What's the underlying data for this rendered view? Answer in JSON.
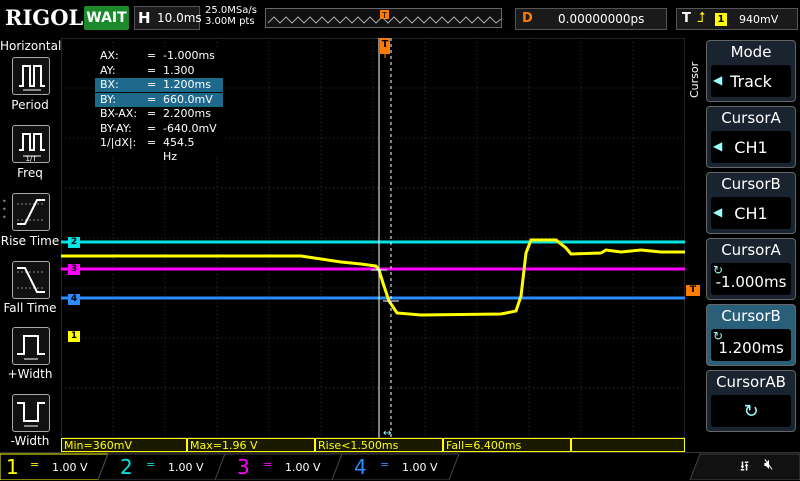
{
  "topbar": {
    "logo": "RIGOL",
    "run_status": "WAIT",
    "timebase_label": "H",
    "timebase_value": "10.0ms",
    "sample_rate": "25.0MSa/s",
    "memory_depth": "3.00M pts",
    "delay_label": "D",
    "delay_value": "0.00000000ps",
    "trigger_type": "T",
    "trigger_source": "1",
    "trigger_level": "940mV"
  },
  "left_menu": {
    "title": "Horizontal",
    "items": [
      {
        "label": "Period",
        "icon": "period-icon"
      },
      {
        "label": "Freq",
        "icon": "freq-icon"
      },
      {
        "label": "Rise Time",
        "icon": "rise-time-icon"
      },
      {
        "label": "Fall Time",
        "icon": "fall-time-icon"
      },
      {
        "label": "+Width",
        "icon": "positive-width-icon"
      },
      {
        "label": "-Width",
        "icon": "negative-width-icon"
      }
    ]
  },
  "cursor_readout": [
    {
      "key": "AX:",
      "eq": "=",
      "value": "-1.000ms",
      "highlight": false
    },
    {
      "key": "AY:",
      "eq": "=",
      "value": "1.300 V",
      "highlight": false
    },
    {
      "key": "BX:",
      "eq": "=",
      "value": "1.200ms",
      "highlight": true
    },
    {
      "key": "BY:",
      "eq": "=",
      "value": "660.0mV",
      "highlight": true
    },
    {
      "key": "BX-AX:",
      "eq": "=",
      "value": "2.200ms",
      "highlight": false
    },
    {
      "key": "BY-AY:",
      "eq": "=",
      "value": "-640.0mV",
      "highlight": false
    },
    {
      "key": "1/|dX|:",
      "eq": "=",
      "value": "454.5 Hz",
      "highlight": false
    }
  ],
  "right_menu": {
    "side_label": "Cursor",
    "items": [
      {
        "caption": "Mode",
        "value": "Track"
      },
      {
        "caption": "CursorA",
        "value": "CH1"
      },
      {
        "caption": "CursorB",
        "value": "CH1"
      },
      {
        "caption": "CursorA",
        "value": "-1.000ms"
      },
      {
        "caption": "CursorB",
        "value": "1.200ms"
      },
      {
        "caption": "CursorAB",
        "value": ""
      }
    ]
  },
  "measurements": {
    "min": "Min=360mV",
    "max": "Max=1.96 V",
    "rise": "Rise<1.500ms",
    "fall": "Fall=6.400ms"
  },
  "channels": [
    {
      "num": "1",
      "scale": "1.00 V",
      "color": "#ffff00"
    },
    {
      "num": "2",
      "scale": "1.00 V",
      "color": "#00e5e5"
    },
    {
      "num": "3",
      "scale": "1.00 V",
      "color": "#ff00ff"
    },
    {
      "num": "4",
      "scale": "1.00 V",
      "color": "#2b8cff"
    }
  ],
  "markers": {
    "ch1": "1",
    "ch2": "2",
    "ch3": "3",
    "ch4": "4",
    "trigger_right": "T",
    "trigger_top": "T"
  },
  "colors": {
    "ch1": "#ffff00",
    "ch2": "#00e5e5",
    "ch3": "#ff00ff",
    "ch4": "#2b8cff",
    "trigger": "#ff7a00",
    "run_status": "#1c8a2a",
    "highlight": "#1f6a8c"
  }
}
